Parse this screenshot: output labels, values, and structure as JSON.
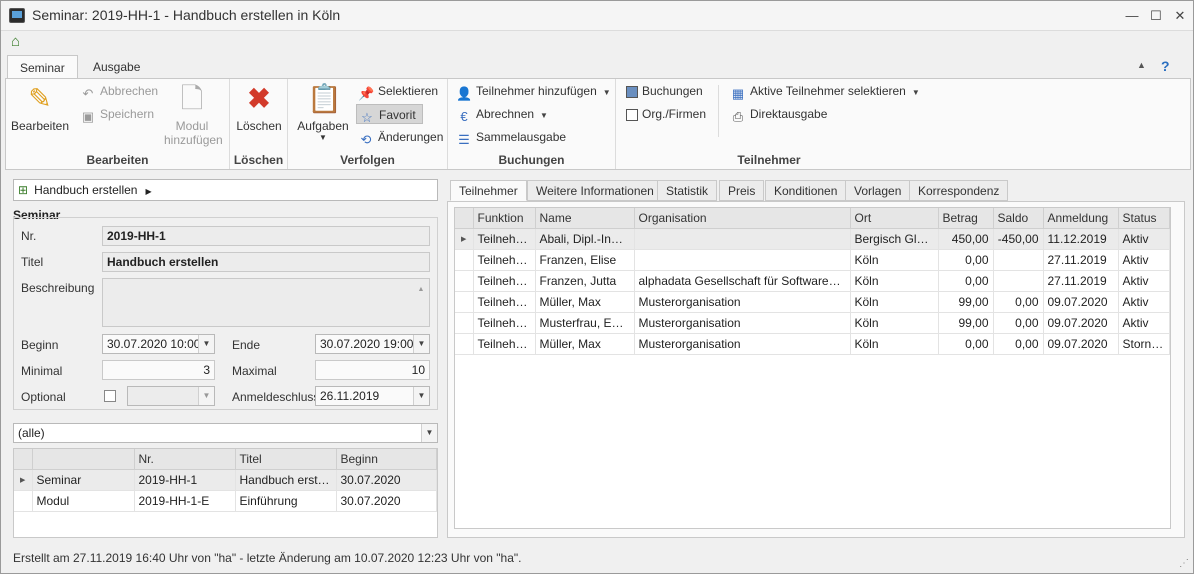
{
  "window": {
    "title": "Seminar: 2019-HH-1 - Handbuch erstellen in Köln",
    "minimize": "—",
    "maximize": "☐",
    "close": "✕"
  },
  "ribbon": {
    "tabs": [
      "Seminar",
      "Ausgabe"
    ],
    "groups": {
      "bearbeiten": {
        "label": "Bearbeiten",
        "edit": "Bearbeiten",
        "cancel": "Abbrechen",
        "save": "Speichern",
        "add_module_1": "Modul",
        "add_module_2": "hinzufügen"
      },
      "loeschen": {
        "label": "Löschen",
        "delete": "Löschen"
      },
      "verfolgen": {
        "label": "Verfolgen",
        "tasks": "Aufgaben",
        "select": "Selektieren",
        "favorite": "Favorit",
        "changes": "Änderungen"
      },
      "buchungen": {
        "label": "Buchungen",
        "add_participant": "Teilnehmer hinzufügen",
        "billing": "Abrechnen",
        "collective_output": "Sammelausgabe"
      },
      "teilnehmer": {
        "label": "Teilnehmer",
        "bookings": "Buchungen",
        "orgs": "Org./Firmen",
        "select_active": "Aktive Teilnehmer selektieren",
        "direct_output": "Direktausgabe"
      }
    }
  },
  "left": {
    "breadcrumb": "Handbuch erstellen",
    "section_title": "Seminar",
    "labels": {
      "nr": "Nr.",
      "titel": "Titel",
      "beschreibung": "Beschreibung",
      "beginn": "Beginn",
      "ende": "Ende",
      "minimal": "Minimal",
      "maximal": "Maximal",
      "optional": "Optional",
      "anmeldeschluss": "Anmeldeschluss"
    },
    "values": {
      "nr": "2019-HH-1",
      "titel": "Handbuch erstellen",
      "beschreibung": "",
      "beginn": "30.07.2020 10:00",
      "ende": "30.07.2020 19:00",
      "minimal": "3",
      "maximal": "10",
      "optional_select": "",
      "anmeldeschluss": "26.11.2019"
    },
    "filter": "(alle)",
    "grid": {
      "columns": [
        "",
        "Nr.",
        "Titel",
        "Beginn"
      ],
      "rows": [
        [
          "Seminar",
          "2019-HH-1",
          "Handbuch erstellen",
          "30.07.2020"
        ],
        [
          "Modul",
          "2019-HH-1-E",
          "Einführung",
          "30.07.2020"
        ]
      ]
    }
  },
  "right": {
    "tabs": [
      "Teilnehmer",
      "Weitere Informationen",
      "Statistik",
      "Preis",
      "Konditionen",
      "Vorlagen",
      "Korrespondenz"
    ],
    "columns": [
      "Funktion",
      "Name",
      "Organisation",
      "Ort",
      "Betrag",
      "Saldo",
      "Anmeldung",
      "Status"
    ],
    "rows": [
      [
        "Teilnehmer",
        "Abali, Dipl.-Ing. ...",
        "",
        "Bergisch Gladb...",
        "450,00",
        "-450,00",
        "11.12.2019",
        "Aktiv"
      ],
      [
        "Teilnehmer",
        "Franzen, Elise",
        "",
        "Köln",
        "0,00",
        "",
        "27.11.2019",
        "Aktiv"
      ],
      [
        "Teilnehmer",
        "Franzen, Jutta",
        "alphadata Gesellschaft für Softwareentwi...",
        "Köln",
        "0,00",
        "",
        "27.11.2019",
        "Aktiv"
      ],
      [
        "Teilnehmer",
        "Müller, Max",
        "Musterorganisation",
        "Köln",
        "99,00",
        "0,00",
        "09.07.2020",
        "Aktiv"
      ],
      [
        "Teilnehmer",
        "Musterfrau, Emil...",
        "Musterorganisation",
        "Köln",
        "99,00",
        "0,00",
        "09.07.2020",
        "Aktiv"
      ],
      [
        "Teilnehmer",
        "Müller, Max",
        "Musterorganisation",
        "Köln",
        "0,00",
        "0,00",
        "09.07.2020",
        "Storniert"
      ]
    ]
  },
  "status": "Erstellt am 27.11.2019 16:40 Uhr von \"ha\" - letzte Änderung am 10.07.2020 12:23 Uhr von \"ha\"."
}
